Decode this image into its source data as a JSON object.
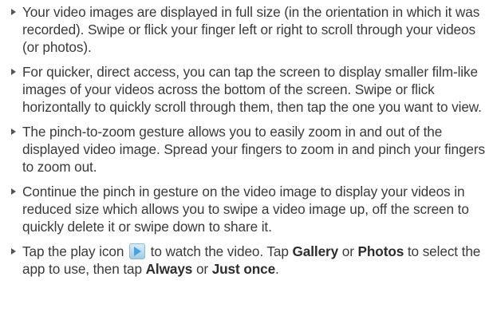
{
  "items": [
    {
      "text": "Your video images are displayed in full size (in the orientation in which it was recorded). Swipe or flick your finger left or right to scroll through your videos (or photos)."
    },
    {
      "text": "For quicker, direct access, you can tap the screen to display smaller film-like images of your videos across the bottom of the screen. Swipe or flick horizontally to quickly scroll through them, then tap the one you want to view."
    },
    {
      "text": "The pinch-to-zoom gesture allows you to easily zoom in and out of the displayed video image. Spread your fingers to zoom in and pinch your fingers to zoom out."
    },
    {
      "text": "Continue the pinch in gesture on the video image to display your videos in reduced size which allows you to swipe a video image up, off the screen to quickly delete it or swipe down to share it."
    }
  ],
  "last_item": {
    "part1": "Tap the play icon ",
    "part2": " to watch the video. Tap ",
    "gallery": "Gallery",
    "part3": " or ",
    "photos": "Photos",
    "part4": " to select the app to use, then tap ",
    "always": "Always",
    "part5": " or ",
    "just_once": "Just once",
    "part6": "."
  },
  "colors": {
    "play_icon": "#7fbfe6"
  },
  "icons": {
    "bullet": "triangle-bullet-icon",
    "play": "play-icon"
  }
}
